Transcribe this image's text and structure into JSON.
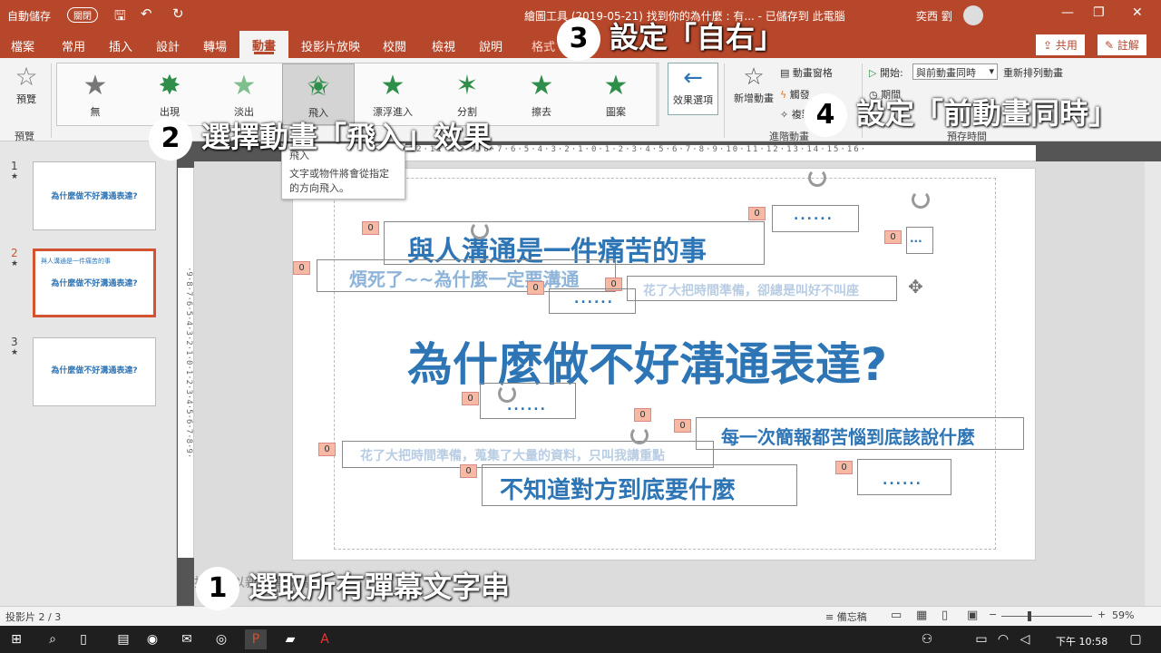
{
  "titlebar": {
    "autosave_label": "自動儲存",
    "autosave_state": "關閉",
    "doc_title": "繪圖工具 (2019-05-21) 找到你的為什麼 : 有... - 已儲存到 此電腦",
    "user_name": "奕西 劉"
  },
  "tabs": [
    "檔案",
    "常用",
    "插入",
    "設計",
    "轉場",
    "動畫",
    "投影片放映",
    "校閱",
    "檢視",
    "說明",
    "格式"
  ],
  "share_label": "共用",
  "comment_label": "註解",
  "ribbon": {
    "preview_label": "預覽",
    "preview_group": "預覽",
    "effects": [
      {
        "label": "無"
      },
      {
        "label": "出現"
      },
      {
        "label": "淡出"
      },
      {
        "label": "飛入"
      },
      {
        "label": "漂浮進入"
      },
      {
        "label": "分割"
      },
      {
        "label": "擦去"
      },
      {
        "label": "圖案"
      }
    ],
    "effect_options_label": "效果選項",
    "add_animation_label": "新增動畫",
    "animation_pane_label": "動畫窗格",
    "trigger_label": "觸發",
    "painter_label": "複製動畫",
    "advanced_group": "進階動畫",
    "start_label": "開始:",
    "start_value": "與前動畫同時",
    "reorder_label": "重新排列動畫",
    "duration_label": "期間",
    "timing_group": "預存時間"
  },
  "tooltip": {
    "title": "飛入",
    "body": "文字或物件將會從指定的方向飛入。"
  },
  "slides": [
    {
      "num": "1",
      "title": "為什麼做不好溝通表達?"
    },
    {
      "num": "2",
      "title": "為什麼做不好溝通表達?",
      "subtitle": "與人溝通是一件痛苦的事"
    },
    {
      "num": "3",
      "title": "為什麼做不好溝通表達?"
    }
  ],
  "slide_content": {
    "main_title": "為什麼做不好溝通表達?",
    "texts": [
      "與人溝通是一件痛苦的事",
      "煩死了~~為什麼一定要溝通",
      "花了大把時間準備，卻總是叫好不叫座",
      "每一次簡報都苦惱到底該說什麼",
      "花了大把時間準備，蒐集了大量的資料，只叫我講重點",
      "不知道對方到底要什麼"
    ],
    "dots": "......",
    "badge": "0"
  },
  "notes_placeholder": "按一下以新增備忘稿",
  "status": {
    "slide_info": "投影片 2 / 3",
    "notes_label": "備忘稿",
    "zoom": "59%"
  },
  "taskbar": {
    "time": "下午 10:58"
  },
  "overlay": [
    {
      "num": "1",
      "text": "選取所有彈幕文字串"
    },
    {
      "num": "2",
      "text": "選擇動畫「飛入」效果"
    },
    {
      "num": "3",
      "text": "設定「自右」"
    },
    {
      "num": "4",
      "text": "設定「前動畫同時」"
    }
  ],
  "colors": {
    "accent": "#b7472a",
    "slide_blue": "#2e75b6",
    "slide_light_blue": "#8fb4d9"
  }
}
